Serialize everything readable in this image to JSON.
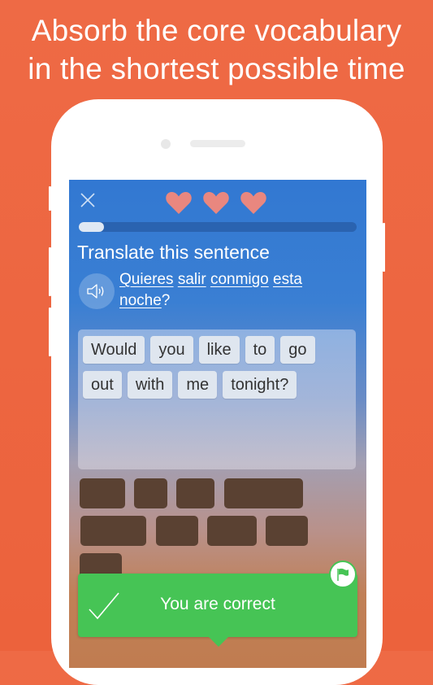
{
  "headline": {
    "line1": "Absorb the core vocabulary",
    "line2": "in the shortest possible time"
  },
  "lesson": {
    "lives": 3,
    "progress_percent": 9,
    "prompt": "Translate this sentence",
    "sentence_words": [
      "Quieres",
      "salir",
      "conmigo",
      "esta",
      "noche"
    ],
    "sentence_punct": "?",
    "answer_words": [
      "Would",
      "you",
      "like",
      "to",
      "go",
      "out",
      "with",
      "me",
      "tonight?"
    ],
    "feedback": {
      "message": "You are correct",
      "status": "correct"
    }
  },
  "icons": {
    "close": "close-icon",
    "heart": "heart-icon",
    "speaker": "speaker-icon",
    "check": "checkmark-icon",
    "flag": "flag-icon"
  },
  "colors": {
    "background": "#ec643e",
    "screen_blue": "#3278d2",
    "heart": "#e9877f",
    "success": "#46c455",
    "blank_tile": "#5a4132"
  }
}
